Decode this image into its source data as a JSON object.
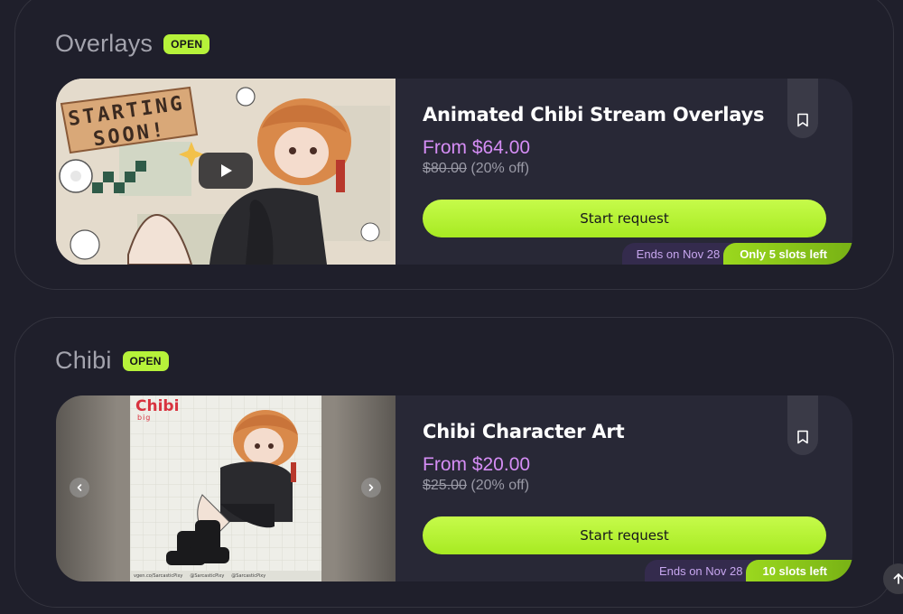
{
  "sections": [
    {
      "title": "Overlays",
      "badge": "OPEN",
      "card": {
        "title": "Animated Chibi Stream Overlays",
        "price": "From $64.00",
        "old_price": "$80.00",
        "discount": "(20% off)",
        "cta": "Start request",
        "ends": "Ends on Nov 28",
        "slots": "Only 5 slots left",
        "media_sign_line1": "STARTING",
        "media_sign_line2": "SOON!"
      }
    },
    {
      "title": "Chibi",
      "badge": "OPEN",
      "card": {
        "title": "Chibi Character Art",
        "price": "From $20.00",
        "old_price": "$25.00",
        "discount": "(20% off)",
        "cta": "Start request",
        "ends": "Ends on Nov 28",
        "slots": "10 slots left",
        "media_logo": "Chibi",
        "media_sub": "big",
        "media_footer": [
          "vgen.co/SarcasticPixy",
          "@SarcasticPixy",
          "@SarcasticPixy"
        ]
      }
    }
  ],
  "icons": {
    "bookmark": "bookmark-icon",
    "play": "play-icon",
    "prev": "chevron-left-icon",
    "next": "chevron-right-icon",
    "scroll_top": "arrow-up-icon"
  },
  "colors": {
    "background": "#1f1f2b",
    "card": "#282836",
    "accent_green": "#b6f23a",
    "price_purple": "#d58df5",
    "ends_bg": "#342b4d"
  }
}
